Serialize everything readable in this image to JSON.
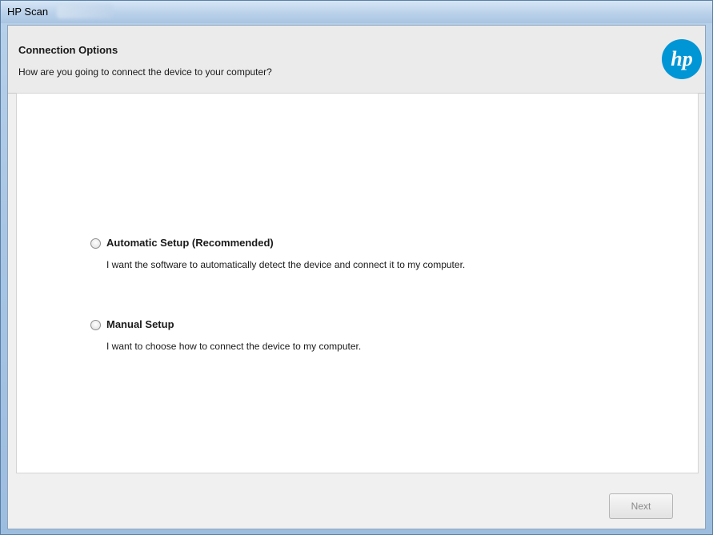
{
  "window": {
    "title": "HP Scan"
  },
  "header": {
    "title": "Connection Options",
    "subtitle": "How are you going to connect the device to your computer?",
    "logo_text": "hp"
  },
  "options": [
    {
      "label": "Automatic Setup (Recommended)",
      "description": "I want the software to automatically detect the device and connect it to my computer.",
      "selected": false
    },
    {
      "label": "Manual Setup",
      "description": "I want to choose how to connect the device to my computer.",
      "selected": false
    }
  ],
  "footer": {
    "next_label": "Next",
    "next_enabled": false
  },
  "colors": {
    "hp_blue": "#0096d6",
    "title_bar": "#bdd3eb",
    "disabled_text": "#8a8a8a"
  }
}
